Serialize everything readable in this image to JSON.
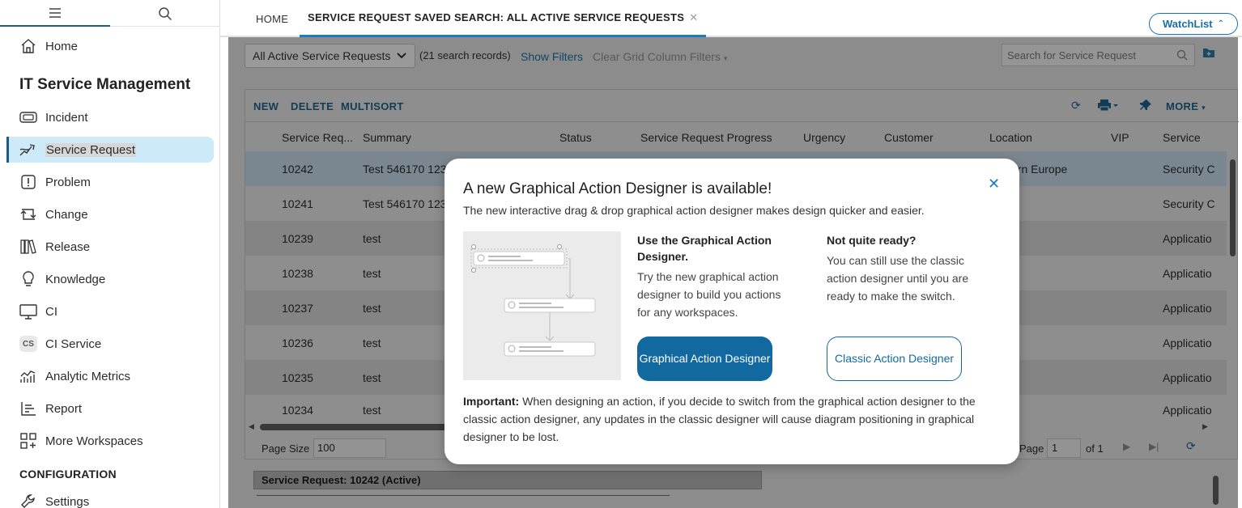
{
  "sidebar": {
    "items": [
      {
        "label": "Home",
        "icon": "home-icon"
      },
      {
        "label": "Incident",
        "icon": "incident-icon"
      },
      {
        "label": "Service Request",
        "icon": "service-request-icon"
      },
      {
        "label": "Problem",
        "icon": "problem-icon"
      },
      {
        "label": "Change",
        "icon": "change-icon"
      },
      {
        "label": "Release",
        "icon": "release-icon"
      },
      {
        "label": "Knowledge",
        "icon": "lightbulb-icon"
      },
      {
        "label": "CI",
        "icon": "monitor-icon"
      },
      {
        "label": "CI Service",
        "icon": "cs-badge-icon",
        "badge": "CS"
      },
      {
        "label": "Analytic Metrics",
        "icon": "analytics-icon"
      },
      {
        "label": "Report",
        "icon": "report-icon"
      },
      {
        "label": "More Workspaces",
        "icon": "workspaces-icon"
      },
      {
        "label": "Settings",
        "icon": "wrench-icon"
      }
    ],
    "heading": "IT Service Management",
    "config_heading": "CONFIGURATION"
  },
  "tabs": {
    "home": "HOME",
    "active": "SERVICE REQUEST SAVED SEARCH: ALL ACTIVE SERVICE REQUESTS",
    "watchlist": "WatchList"
  },
  "search_bar": {
    "saved_search": "All Active Service Requests",
    "record_count": "(21 search records)",
    "show_filters": "Show Filters",
    "clear_filters": "Clear Grid Column Filters",
    "search_placeholder": "Search for Service Request"
  },
  "grid": {
    "toolbar": {
      "new": "NEW",
      "delete": "DELETE",
      "multisort": "MULTISORT",
      "more": "MORE"
    },
    "columns": [
      "Service Req...",
      "Summary",
      "Status",
      "Service Request Progress",
      "Urgency",
      "Customer",
      "Location",
      "VIP",
      "Service"
    ],
    "rows": [
      {
        "id": "10242",
        "summary": "Test 546170 1234",
        "location": "ern Europe",
        "service": "Security C"
      },
      {
        "id": "10241",
        "summary": "Test 546170 1234",
        "location": "",
        "service": "Security C"
      },
      {
        "id": "10239",
        "summary": "test",
        "location": "",
        "service": "Applicatio"
      },
      {
        "id": "10238",
        "summary": "test",
        "location": "",
        "service": "Applicatio"
      },
      {
        "id": "10237",
        "summary": "test",
        "location": "",
        "service": "Applicatio"
      },
      {
        "id": "10236",
        "summary": "test",
        "location": "",
        "service": "Applicatio"
      },
      {
        "id": "10235",
        "summary": "test",
        "location": "",
        "service": "Applicatio"
      },
      {
        "id": "10234",
        "summary": "test",
        "location": "",
        "service": "Applicatio"
      }
    ],
    "pager": {
      "page_size_label": "Page Size",
      "page_size": "100",
      "page_label": "Page",
      "page": "1",
      "of": "of 1"
    }
  },
  "detail": {
    "tab": "Service Request: 10242 (Active)"
  },
  "modal": {
    "title": "A new Graphical Action Designer is available!",
    "subtitle": "The new interactive drag & drop graphical action designer makes design quicker and easier.",
    "left_heading": "Use the Graphical Action Designer.",
    "left_text": "Try the new graphical action designer to build you actions for any workspaces.",
    "right_heading": "Not quite ready?",
    "right_text": "You can still use the classic action designer until you are ready to make the switch.",
    "primary_button": "Graphical Action Designer",
    "secondary_button": "Classic Action Designer",
    "note_label": "Important:",
    "note_text": " When designing an action, if you decide to switch from the graphical action designer to the classic action designer, any updates in the classic designer will cause diagram positioning in graphical designer to be lost."
  }
}
